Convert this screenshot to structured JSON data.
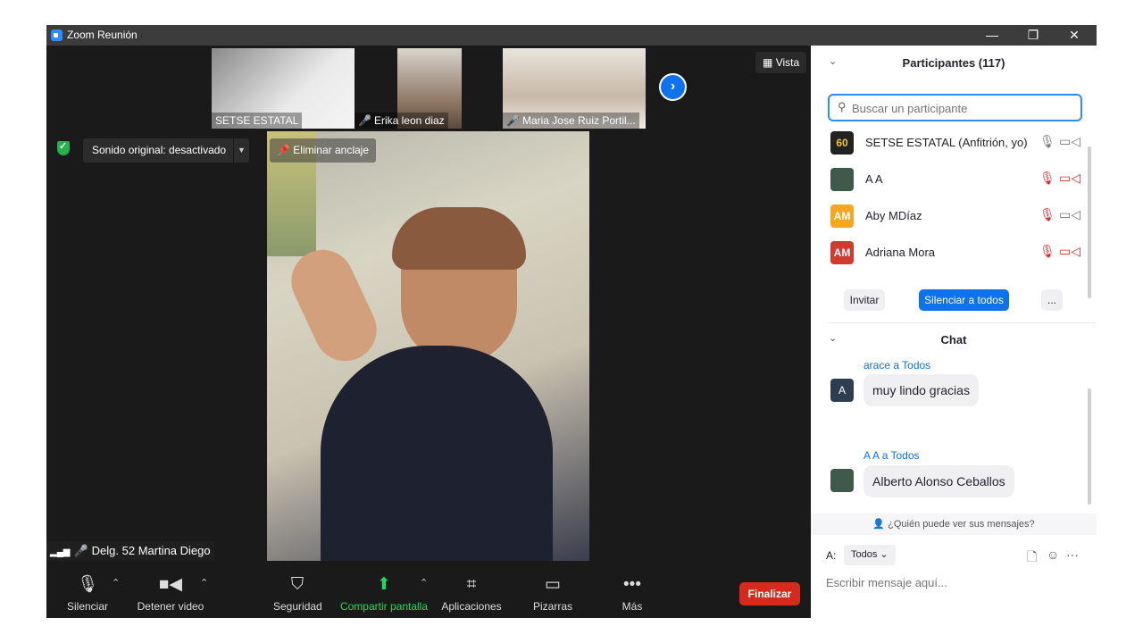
{
  "window": {
    "title": "Zoom Reunión",
    "minimize": "—",
    "restore": "❐",
    "close": "✕"
  },
  "video": {
    "thumbnails": [
      {
        "name": "SETSE ESTATAL",
        "muted": false
      },
      {
        "name": "Erika leon diaz",
        "muted": true
      },
      {
        "name": "Maria Jose Ruiz Portil...",
        "muted": true
      }
    ],
    "next_page_icon": "chevron-right-icon",
    "view_label": "Vista",
    "sound_label": "Sonido original: desactivado",
    "unpin_label": "Eliminar anclaje",
    "active_speaker": "Delg. 52 Martina Diego"
  },
  "toolbar": {
    "mute_label": "Silenciar",
    "video_label": "Detener video",
    "security_label": "Seguridad",
    "share_label": "Compartir pantalla",
    "apps_label": "Aplicaciones",
    "whiteboards_label": "Pizarras",
    "more_label": "Más",
    "end_label": "Finalizar",
    "share_color": "#23d959",
    "end_color": "#d52b1e"
  },
  "participants": {
    "title": "Participantes (117)",
    "search_placeholder": "Buscar un participante",
    "items": [
      {
        "name": "SETSE ESTATAL (Anfitrión, yo)",
        "avatar": "60",
        "avatar_color": "#222222",
        "mic_muted": false,
        "cam_off": false
      },
      {
        "name": "A A",
        "avatar": "",
        "avatar_color": "#3d5a4a",
        "mic_muted": true,
        "cam_off": true
      },
      {
        "name": "Aby MDíaz",
        "avatar": "AM",
        "avatar_color": "#f5a623",
        "mic_muted": true,
        "cam_off": false
      },
      {
        "name": "Adriana Mora",
        "avatar": "AM",
        "avatar_color": "#d13b2f",
        "mic_muted": true,
        "cam_off": true
      }
    ],
    "invite_label": "Invitar",
    "mute_all_label": "Silenciar a todos",
    "more_label": "..."
  },
  "chat": {
    "title": "Chat",
    "messages": [
      {
        "sender": "arace a Todos",
        "text": "muy lindo gracias",
        "avatar": "A",
        "avatar_color": "#2c3e50"
      },
      {
        "sender": "A A a Todos",
        "text": "Alberto Alonso Ceballos",
        "avatar": "",
        "avatar_color": "#3d5a4a"
      }
    ],
    "who_can_see": "¿Quién puede ver sus mensajes?",
    "to_label": "A:",
    "to_value": "Todos",
    "input_placeholder": "Escribir mensaje aquí..."
  }
}
